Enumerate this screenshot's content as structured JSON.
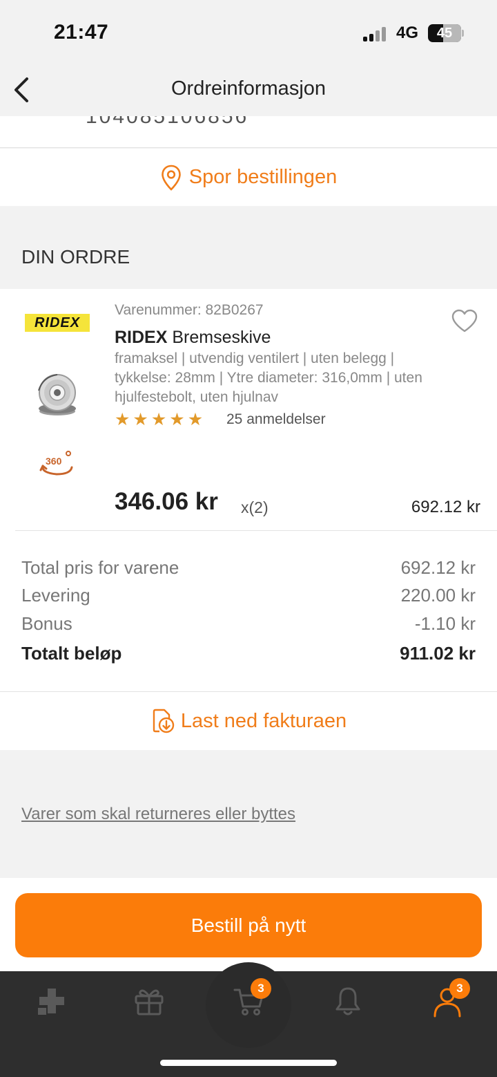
{
  "status_bar": {
    "time": "21:47",
    "network": "4G",
    "battery": "45"
  },
  "header": {
    "title": "Ordreinformasjon",
    "back_icon": "chevron-left-icon"
  },
  "order_number_cut": "104085106856",
  "track_order": {
    "label": "Spor bestillingen",
    "icon": "location-pin-icon"
  },
  "order_section": {
    "heading": "DIN ORDRE"
  },
  "product": {
    "brand_logo": "RIDEX",
    "article_number": "Varenummer: 82B0267",
    "brand": "RIDEX",
    "name": "Bremseskive",
    "description": "framaksel | utvendig ventilert | uten belegg | tykkelse: 28mm | Ytre diameter: 316,0mm | uten hjulfestebolt, uten hjulnav",
    "rating": 5,
    "reviews": "25 anmeldelser",
    "unit_price": "346.06 kr",
    "quantity": "x(2)",
    "line_total": "692.12 kr",
    "view_360_label": "360"
  },
  "summary": {
    "items": [
      {
        "label": "Total pris for varene",
        "value": "692.12 kr"
      },
      {
        "label": "Levering",
        "value": "220.00 kr"
      },
      {
        "label": "Bonus",
        "value": "-1.10 kr"
      }
    ],
    "total": {
      "label": "Totalt beløp",
      "value": "911.02 kr"
    }
  },
  "invoice": {
    "label": "Last ned fakturaen",
    "icon": "download-document-icon"
  },
  "returns_link": "Varer som skal returneres eller byttes",
  "reorder_button": "Bestill på nytt",
  "tab_bar": {
    "tabs": [
      {
        "icon": "catalog-icon"
      },
      {
        "icon": "gift-icon"
      },
      {
        "icon": "cart-icon",
        "badge": "3"
      },
      {
        "icon": "bell-icon"
      },
      {
        "icon": "profile-icon",
        "badge": "3"
      }
    ]
  },
  "colors": {
    "accent": "#fb7c0a",
    "accent_text": "#f07d1a",
    "star": "#e29a2b",
    "tabbar": "#2e2e2e"
  }
}
